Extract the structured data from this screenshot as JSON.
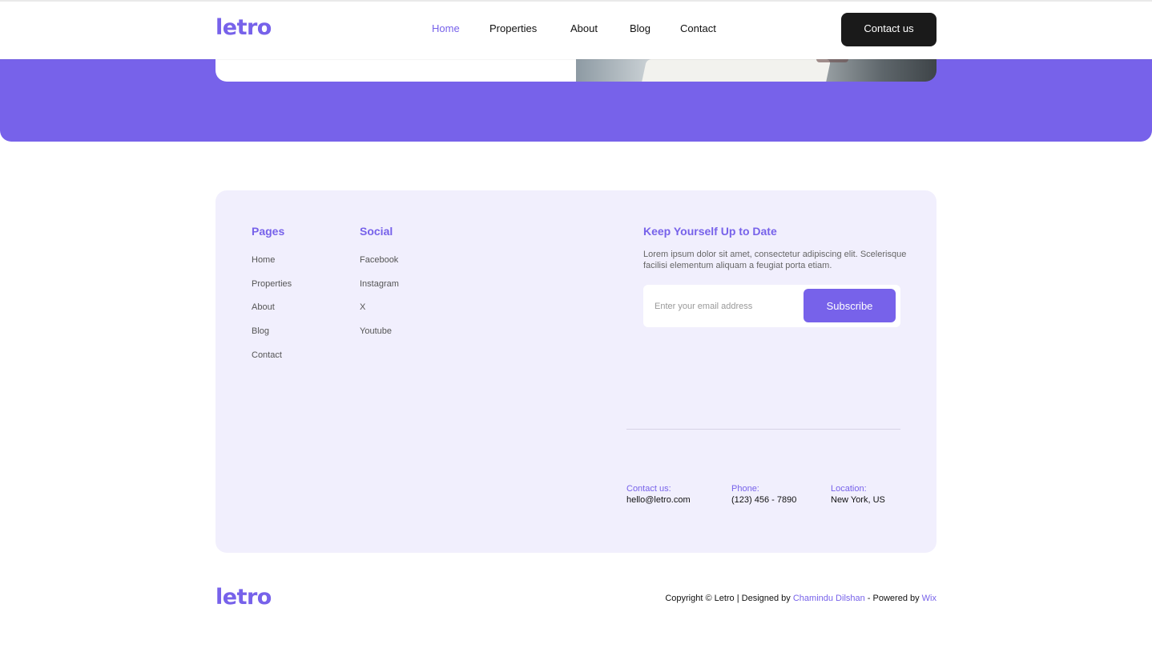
{
  "header": {
    "logo": "letro",
    "nav": [
      {
        "label": "Home",
        "active": true
      },
      {
        "label": "Properties",
        "active": false
      },
      {
        "label": "About",
        "active": false
      },
      {
        "label": "Blog",
        "active": false
      },
      {
        "label": "Contact",
        "active": false
      }
    ],
    "cta_label": "Contact us"
  },
  "footer": {
    "pages": {
      "title": "Pages",
      "items": [
        "Home",
        "Properties",
        "About",
        "Blog",
        "Contact"
      ]
    },
    "social": {
      "title": "Social",
      "items": [
        "Facebook",
        "Instagram",
        "X",
        "Youtube"
      ]
    },
    "newsletter": {
      "title": "Keep Yourself Up to Date",
      "text": "Lorem ipsum dolor sit amet, consectetur adipiscing elit. Scelerisque facilisi elementum aliquam a feugiat porta etiam.",
      "input_placeholder": "Enter your email address",
      "button_label": "Subscribe"
    },
    "contact": [
      {
        "label": "Contact us:",
        "value": "hello@letro.com"
      },
      {
        "label": "Phone:",
        "value": "(123) 456 - 7890"
      },
      {
        "label": "Location:",
        "value": "New York, US"
      }
    ]
  },
  "bottom": {
    "logo": "letro",
    "copyright_prefix": "Copyright © Letro | Designed by ",
    "designer": "Chamindu Dilshan",
    "powered_prefix": " - Powered by ",
    "platform": "Wix"
  },
  "colors": {
    "accent": "#7762ea",
    "dark_button": "#1a1a1a",
    "footer_bg": "#f1effd"
  },
  "icons": []
}
